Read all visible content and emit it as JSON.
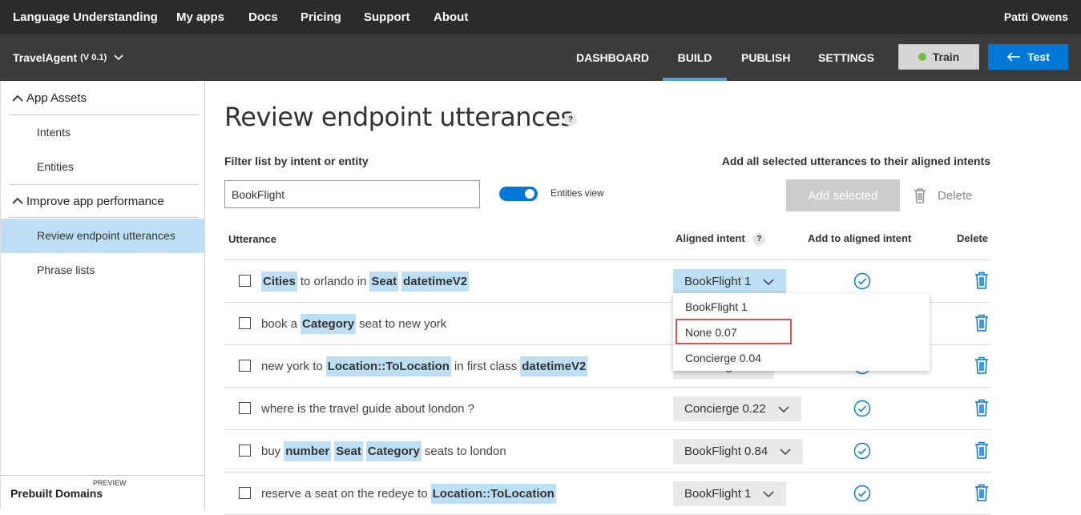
{
  "topnav": {
    "brand": "Language Understanding",
    "links": [
      "My apps",
      "Docs",
      "Pricing",
      "Support",
      "About"
    ],
    "user": "Patti Owens"
  },
  "subnav": {
    "app_name": "TravelAgent",
    "version": "(V 0.1)",
    "tabs": [
      "DASHBOARD",
      "BUILD",
      "PUBLISH",
      "SETTINGS"
    ],
    "active_tab": "BUILD",
    "train_label": "Train",
    "test_label": "Test"
  },
  "sidebar": {
    "sections": [
      {
        "label": "App Assets",
        "items": [
          "Intents",
          "Entities"
        ]
      },
      {
        "label": "Improve app performance",
        "items": [
          "Review endpoint utterances",
          "Phrase lists"
        ]
      }
    ],
    "active_item": "Review endpoint utterances",
    "footer_label": "Prebuilt Domains",
    "footer_badge": "PREVIEW"
  },
  "main": {
    "title": "Review endpoint utterances",
    "help_glyph": "?",
    "filter_label": "Filter list by intent or entity",
    "filter_value": "BookFlight",
    "toggle_label": "Entities view",
    "add_all_label": "Add all selected utterances to their aligned intents",
    "add_selected_label": "Add selected",
    "delete_label": "Delete",
    "columns": {
      "utterance": "Utterance",
      "aligned_intent": "Aligned intent",
      "add_to_aligned": "Add to aligned intent",
      "delete": "Delete"
    },
    "rows": [
      {
        "tokens": [
          {
            "t": "Cities",
            "e": true
          },
          {
            "t": "to orlando in",
            "e": false
          },
          {
            "t": "Seat",
            "e": true
          },
          {
            "t": "datetimeV2",
            "e": true
          }
        ],
        "intent": "BookFlight 1",
        "selected": true
      },
      {
        "tokens": [
          {
            "t": "book a",
            "e": false
          },
          {
            "t": "Category",
            "e": true
          },
          {
            "t": "seat to new york",
            "e": false
          }
        ],
        "intent": "",
        "selected": false
      },
      {
        "tokens": [
          {
            "t": "new york to",
            "e": false
          },
          {
            "t": "Location::ToLocation",
            "e": true
          },
          {
            "t": "in first class",
            "e": false
          },
          {
            "t": "datetimeV2",
            "e": true
          }
        ],
        "intent": "Concierge",
        "selected": false
      },
      {
        "tokens": [
          {
            "t": "where is the travel guide about london ?",
            "e": false
          }
        ],
        "intent": "Concierge 0.22",
        "selected": false
      },
      {
        "tokens": [
          {
            "t": "buy",
            "e": false
          },
          {
            "t": "number",
            "e": true
          },
          {
            "t": "Seat",
            "e": true
          },
          {
            "t": "Category",
            "e": true
          },
          {
            "t": "seats to london",
            "e": false
          }
        ],
        "intent": "BookFlight 0.84",
        "selected": false
      },
      {
        "tokens": [
          {
            "t": "reserve a seat on the redeye to",
            "e": false
          },
          {
            "t": "Location::ToLocation",
            "e": true
          }
        ],
        "intent": "BookFlight 1",
        "selected": false
      }
    ],
    "dropdown_options": [
      "BookFlight 1",
      "None 0.07",
      "Concierge 0.04"
    ],
    "dropdown_highlighted": "None 0.07"
  },
  "colors": {
    "topbar": "#2b2b2b",
    "subbar": "#3b3b3b",
    "accent": "#0078d7",
    "entity_highlight": "#bcdff5",
    "train_dot": "#6cbf3a",
    "outline_red": "#d9534f"
  }
}
